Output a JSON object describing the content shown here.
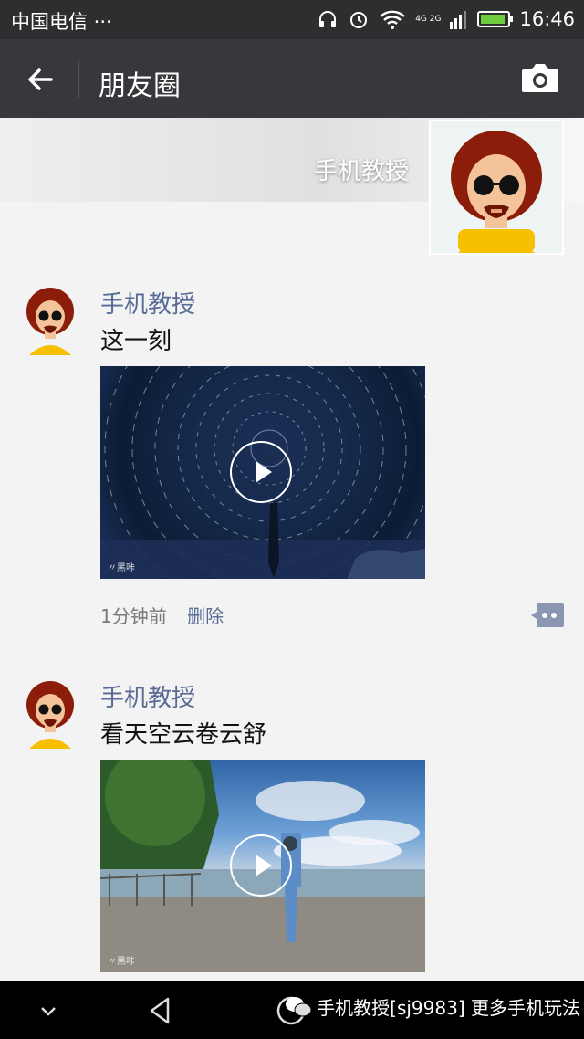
{
  "status_bar": {
    "carrier": "中国电信 ···",
    "network": "4G 2G",
    "time": "16:46"
  },
  "app_bar": {
    "title": "朋友圈"
  },
  "cover": {
    "user_name": "手机教授"
  },
  "posts": [
    {
      "name": "手机教授",
      "text": "这一刻",
      "time": "1分钟前",
      "delete_label": "删除",
      "video_watermark": "〃黑咔"
    },
    {
      "name": "手机教授",
      "text": "看天空云卷云舒",
      "video_watermark": "〃黑咔"
    }
  ],
  "bottom_watermark": "手机教授[sj9983] 更多手机玩法",
  "colors": {
    "link": "#576b95",
    "header_bg": "#38383c",
    "status_bg": "#2e2e30"
  }
}
